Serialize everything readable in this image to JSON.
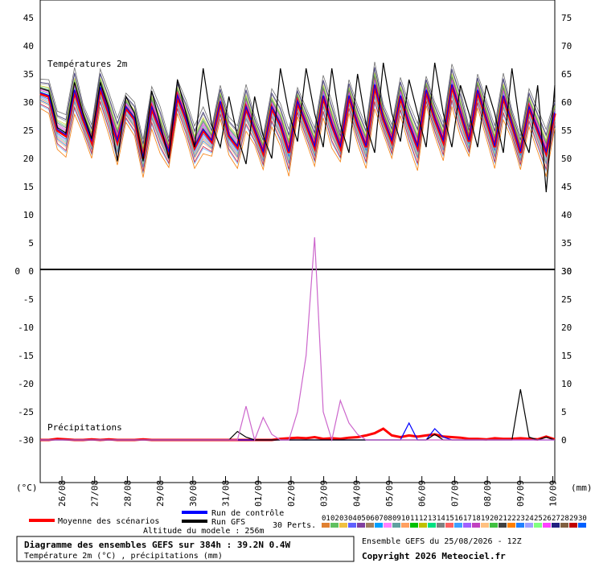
{
  "chart_data": {
    "type": "line",
    "x_dates": [
      "26/08",
      "27/08",
      "28/08",
      "29/08",
      "30/08",
      "31/08",
      "01/09",
      "02/09",
      "03/09",
      "04/09",
      "05/09",
      "06/09",
      "07/09",
      "08/09",
      "09/09",
      "10/09"
    ],
    "temperature_panel": {
      "title": "Températures 2m",
      "ylim": [
        0,
        45
      ],
      "yticks_left": [
        0,
        5,
        10,
        15,
        20,
        25,
        30,
        35,
        40,
        45
      ],
      "yticks_right": [
        30,
        35,
        40,
        45,
        50,
        55,
        60,
        65,
        70,
        75
      ],
      "series": [
        {
          "name": "Moyenne des scénarios",
          "color": "#ff0000",
          "values": [
            31.5,
            31,
            25,
            24,
            32,
            27,
            23,
            32.5,
            28,
            23,
            29,
            27,
            20,
            29,
            25,
            21,
            31,
            27,
            22,
            25,
            23,
            30,
            24,
            22,
            29,
            25,
            21,
            29,
            26,
            21,
            30,
            26,
            22,
            31,
            26,
            22,
            31,
            26,
            22,
            33,
            27,
            23,
            31,
            26,
            22,
            32,
            27,
            23,
            33,
            28,
            23,
            32,
            27,
            22,
            31,
            26,
            21,
            29,
            25,
            21,
            28
          ]
        },
        {
          "name": "Run de contrôle",
          "color": "#0000ff",
          "values": [
            31.7,
            31.2,
            25.2,
            24.2,
            32.2,
            27.2,
            23.2,
            32.7,
            28.2,
            23.2,
            29.2,
            27.2,
            20.2,
            29.2,
            25.2,
            21.2,
            31.2,
            27.2,
            22.2,
            25.2,
            23.2,
            30.2,
            24.2,
            22.2,
            29.2,
            25.2,
            21.2,
            29.2,
            26.2,
            21.2,
            30.2,
            26.2,
            22.2,
            31.2,
            26.2,
            22.2,
            31.2,
            26.2,
            22.2,
            33.2,
            27.2,
            23.2,
            31.2,
            26.2,
            22.2,
            32.2,
            27.2,
            23.2,
            33.2,
            28.2,
            23.2,
            32.2,
            27.2,
            22.2,
            31.2,
            26.2,
            21.2,
            29.2,
            25.2,
            21.2,
            28.2
          ]
        },
        {
          "name": "Run GFS",
          "color": "#000000",
          "values": [
            32.5,
            32,
            25.5,
            24.5,
            33.5,
            28,
            23.5,
            33.5,
            29,
            19.5,
            31,
            28,
            19.5,
            32,
            26,
            20,
            34,
            28,
            22,
            36,
            26,
            22,
            31,
            24,
            19,
            31,
            24,
            20,
            36,
            28,
            23,
            36,
            28,
            22,
            36,
            26,
            21,
            35,
            26,
            21,
            37,
            28,
            23,
            34,
            28,
            22,
            37,
            28,
            22,
            33,
            28,
            22,
            33,
            28,
            21,
            36,
            25,
            21,
            33,
            14,
            33
          ]
        }
      ]
    },
    "precip_panel": {
      "title": "Précipitations",
      "ylim_left": [
        -30,
        0
      ],
      "yticks_left": [
        -30,
        -25,
        -20,
        -15,
        -10,
        -5,
        0
      ],
      "yticks_right": [
        0,
        5,
        10,
        15,
        20,
        25,
        30
      ],
      "series": [
        {
          "name": "Moyenne des scénarios",
          "color": "#ff0000",
          "values": [
            0,
            0,
            0.2,
            0.1,
            0,
            0,
            0.1,
            0,
            0.1,
            0,
            0,
            0,
            0.1,
            0,
            0,
            0,
            0,
            0,
            0,
            0,
            0,
            0,
            0,
            0,
            0,
            0,
            0,
            0,
            0.2,
            0.3,
            0.4,
            0.3,
            0.5,
            0.2,
            0.3,
            0.2,
            0.4,
            0.5,
            0.8,
            1.2,
            2,
            0.8,
            0.5,
            0.8,
            0.6,
            0.8,
            1,
            0.6,
            0.5,
            0.4,
            0.2,
            0.2,
            0.1,
            0.3,
            0.2,
            0.2,
            0.3,
            0.2,
            0.1,
            0.6,
            0.1
          ]
        },
        {
          "name": "Run de contrôle",
          "color": "#0000ff",
          "values": [
            0,
            0,
            0,
            0,
            0,
            0,
            0,
            0,
            0,
            0,
            0,
            0,
            0,
            0,
            0,
            0,
            0,
            0,
            0,
            0,
            0,
            0,
            0,
            0,
            0,
            0,
            0,
            0,
            0,
            0,
            0,
            0,
            0,
            0,
            0,
            0,
            0,
            0,
            0,
            0,
            0,
            0,
            0,
            3,
            0,
            0,
            2,
            0.5,
            0,
            0,
            0,
            0,
            0,
            0,
            0,
            0,
            0,
            0,
            0,
            0,
            0
          ]
        },
        {
          "name": "Run GFS",
          "color": "#000000",
          "values": [
            0,
            0,
            0,
            0,
            0,
            0,
            0,
            0,
            0,
            0,
            0,
            0,
            0,
            0,
            0,
            0,
            0,
            0,
            0,
            0,
            0,
            0,
            0,
            1.5,
            0.5,
            0,
            0,
            0,
            0,
            0,
            0,
            0,
            0,
            0,
            0,
            0,
            0,
            0,
            0,
            0,
            0,
            0,
            0,
            0,
            0,
            0,
            1,
            0,
            0,
            0,
            0,
            0,
            0,
            0,
            0,
            0,
            9,
            0.5,
            0,
            0.5,
            0
          ]
        },
        {
          "name": "04",
          "color": "#cc66cc",
          "values": [
            0,
            0,
            0,
            0,
            0,
            0,
            0,
            0,
            0,
            0,
            0,
            0,
            0,
            0,
            0,
            0,
            0,
            0,
            0,
            0,
            0,
            0,
            0,
            0,
            6,
            0,
            4,
            1,
            0,
            0,
            5,
            15,
            36,
            5,
            0,
            7,
            3,
            1,
            0,
            0,
            0,
            0,
            0,
            0,
            0,
            0,
            0,
            0,
            0,
            0,
            0,
            0,
            0,
            0,
            0,
            0,
            0,
            0,
            0,
            0,
            0
          ]
        }
      ]
    },
    "axis_unit_left": "(°C)",
    "axis_unit_right": "(mm)",
    "legend": {
      "mean": "Moyenne des scénarios",
      "control": "Run de contrôle",
      "gfs": "Run GFS",
      "perts": "30 Perts.",
      "altitude": "Altitude du modele : 256m",
      "pert_labels": [
        "01",
        "02",
        "03",
        "04",
        "05",
        "06",
        "07",
        "08",
        "09",
        "10",
        "11",
        "12",
        "13",
        "14",
        "15",
        "16",
        "17",
        "18",
        "19",
        "20",
        "21",
        "22",
        "23",
        "24",
        "25",
        "26",
        "27",
        "28",
        "29",
        "30"
      ],
      "pert_colors": [
        "#e08030",
        "#60c060",
        "#f0c040",
        "#6060ff",
        "#8040a0",
        "#a08060",
        "#00a0ff",
        "#ff80ff",
        "#60a0a0",
        "#ffa060",
        "#00c000",
        "#c0c000",
        "#00e080",
        "#808080",
        "#ff6060",
        "#40a0ff",
        "#a060ff",
        "#c040c0",
        "#ffc080",
        "#40c040",
        "#404040",
        "#ff8000",
        "#2080ff",
        "#a0a0ff",
        "#80ff80",
        "#ff40ff",
        "#202080",
        "#806040",
        "#c00000",
        "#0060ff"
      ]
    },
    "footer": {
      "title": "Diagramme des ensembles GEFS sur 384h : 39.2N 0.4W",
      "subtitle": "Température 2m (°C) , précipitations (mm)",
      "ensemble": "Ensemble GEFS du 25/08/2026 - 12Z",
      "copyright": "Copyright 2026 Meteociel.fr"
    }
  }
}
